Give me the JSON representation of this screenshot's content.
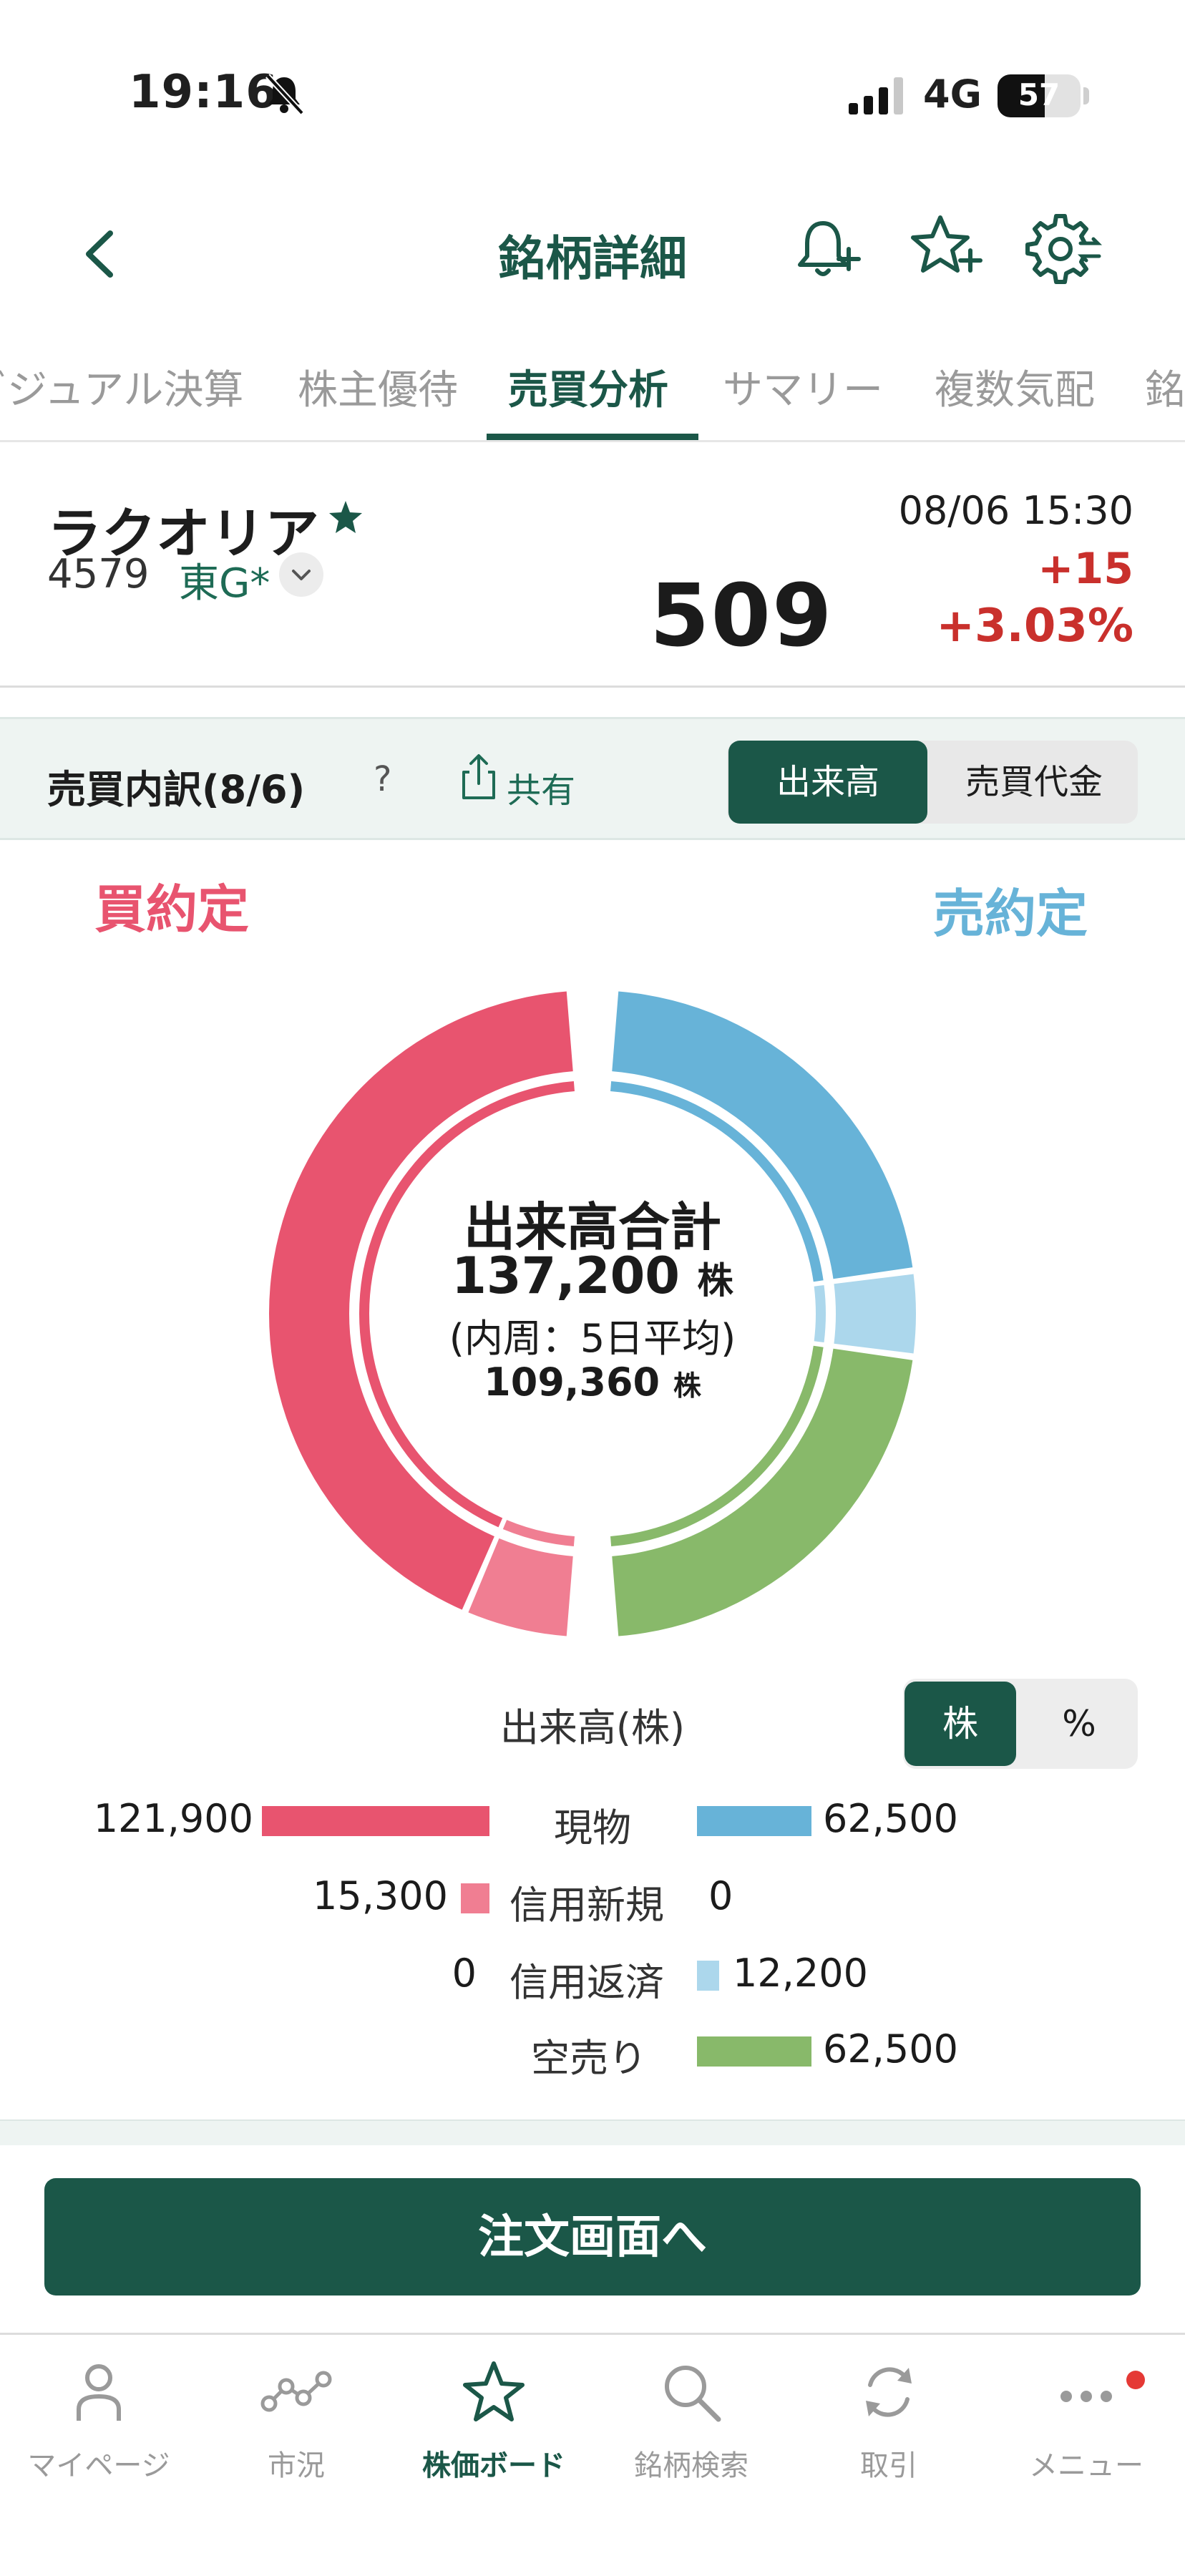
{
  "status_bar": {
    "time": "19:16",
    "network": "4G",
    "battery": "57",
    "battery_level": 0.57
  },
  "header": {
    "title": "銘柄詳細"
  },
  "tabs": [
    {
      "label": "ビジュアル決算"
    },
    {
      "label": "株主優待"
    },
    {
      "label": "売買分析",
      "active": true
    },
    {
      "label": "サマリー"
    },
    {
      "label": "複数気配"
    },
    {
      "label": "銘柄"
    }
  ],
  "stock": {
    "name": "ラクオリア",
    "code": "4579",
    "market": "東G*",
    "datetime": "08/06 15:30",
    "price": "509",
    "change": "+15",
    "change_pct": "+3.03%"
  },
  "breakdown": {
    "title": "売買内訳(8/6)",
    "help": "?",
    "share": "共有",
    "segment": {
      "volume": "出来高",
      "value": "売買代金"
    },
    "buy_label": "買約定",
    "sell_label": "売約定",
    "center": {
      "title": "出来高合計",
      "total": "137,200",
      "unit": "株",
      "note": "(内周：5日平均)",
      "avg": "109,360"
    },
    "table_title": "出来高(株)",
    "unit_toggle": {
      "shares": "株",
      "percent": "%"
    },
    "rows": [
      {
        "label": "現物",
        "buy": "121,900",
        "sell": "62,500"
      },
      {
        "label": "信用新規",
        "buy": "15,300",
        "sell": "0"
      },
      {
        "label": "信用返済",
        "buy": "0",
        "sell": "12,200"
      },
      {
        "label": "空売り",
        "buy": "",
        "sell": "62,500"
      }
    ]
  },
  "chart_data": {
    "type": "pie",
    "buy": [
      {
        "name": "現物",
        "value": 121900,
        "color": "#e8546f"
      },
      {
        "name": "信用新規",
        "value": 15300,
        "color": "#f07e92"
      },
      {
        "name": "信用返済",
        "value": 0,
        "color": "#f5b7c2"
      }
    ],
    "sell": [
      {
        "name": "現物",
        "value": 62500,
        "color": "#67b3d8"
      },
      {
        "name": "信用新規",
        "value": 0,
        "color": "#8cc8e6"
      },
      {
        "name": "信用返済",
        "value": 12200,
        "color": "#acd7ec"
      },
      {
        "name": "空売り",
        "value": 62500,
        "color": "#88b96a"
      }
    ]
  },
  "order_button": {
    "label": "注文画面へ"
  },
  "bottom_nav": [
    {
      "label": "マイページ",
      "icon": "person-icon"
    },
    {
      "label": "市況",
      "icon": "market-chart-icon"
    },
    {
      "label": "株価ボード",
      "icon": "star-icon",
      "active": true
    },
    {
      "label": "銘柄検索",
      "icon": "search-icon"
    },
    {
      "label": "取引",
      "icon": "refresh-icon"
    },
    {
      "label": "メニュー",
      "icon": "more-icon",
      "badge": true
    }
  ]
}
